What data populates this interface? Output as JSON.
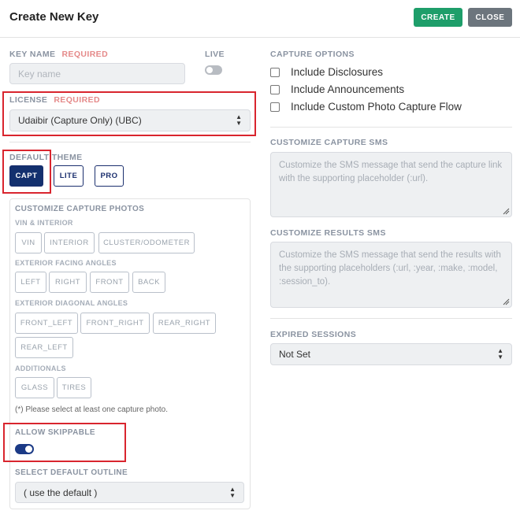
{
  "header": {
    "title": "Create New Key",
    "create_label": "CREATE",
    "close_label": "CLOSE"
  },
  "key_name": {
    "label": "KEY NAME",
    "required": "REQUIRED",
    "placeholder": "Key name"
  },
  "live": {
    "label": "LIVE",
    "on": false
  },
  "license": {
    "label": "LICENSE",
    "required": "REQUIRED",
    "value": "Udaibir (Capture Only) (UBC)"
  },
  "default_theme": {
    "label": "DEFAULT THEME",
    "options": [
      "CAPT",
      "LITE",
      "PRO"
    ],
    "selected": "CAPT"
  },
  "capture_photos": {
    "label": "CUSTOMIZE CAPTURE PHOTOS",
    "groups": [
      {
        "label": "VIN & INTERIOR",
        "items": [
          "VIN",
          "INTERIOR",
          "CLUSTER/ODOMETER"
        ]
      },
      {
        "label": "EXTERIOR FACING ANGLES",
        "items": [
          "LEFT",
          "RIGHT",
          "FRONT",
          "BACK"
        ]
      },
      {
        "label": "EXTERIOR DIAGONAL ANGLES",
        "items": [
          "FRONT_LEFT",
          "FRONT_RIGHT",
          "REAR_RIGHT",
          "REAR_LEFT"
        ]
      },
      {
        "label": "ADDITIONALS",
        "items": [
          "GLASS",
          "TIRES"
        ]
      }
    ],
    "note": "(*) Please select at least one capture photo."
  },
  "allow_skippable": {
    "label": "ALLOW SKIPPABLE",
    "on": true
  },
  "default_outline": {
    "label": "SELECT DEFAULT OUTLINE",
    "value": "( use the default )"
  },
  "capture_options": {
    "label": "CAPTURE OPTIONS",
    "items": [
      "Include Disclosures",
      "Include Announcements",
      "Include Custom Photo Capture Flow"
    ]
  },
  "capture_sms": {
    "label": "CUSTOMIZE CAPTURE SMS",
    "placeholder": "Customize the SMS message that send the capture link with the supporting placeholder (:url)."
  },
  "results_sms": {
    "label": "CUSTOMIZE RESULTS SMS",
    "placeholder": "Customize the SMS message that send the results with the supporting placeholders (:url, :year, :make, :model, :session_to)."
  },
  "expired_sessions": {
    "label": "EXPIRED SESSIONS",
    "value": "Not Set"
  },
  "colors": {
    "primary": "#13306e",
    "success": "#1e9e6a",
    "secondary": "#6c757d",
    "highlight": "#d9252e",
    "required": "#e58a8a"
  }
}
